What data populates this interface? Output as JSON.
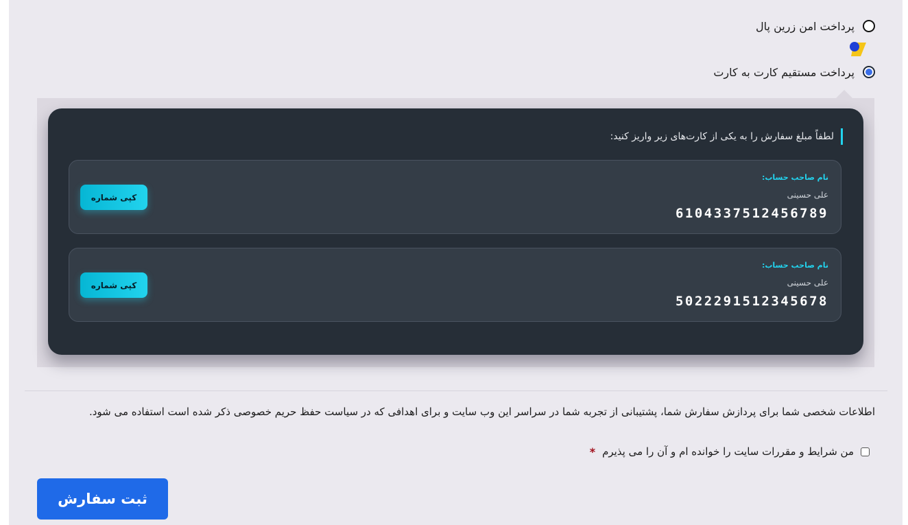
{
  "payment_options": [
    {
      "label": "پرداخت امن زرین پال",
      "checked": false
    },
    {
      "label": "پرداخت مستقیم کارت به کارت",
      "checked": true
    }
  ],
  "card_panel": {
    "instruction": "لطفاً مبلغ سفارش را به یکی از کارت‌های زیر واریز کنید:",
    "accounts": [
      {
        "holder_label": "نام صاحب حساب:",
        "holder_name": "علی حسینی",
        "card_number": "6104337512456789",
        "copy_label": "کپی شماره"
      },
      {
        "holder_label": "نام صاحب حساب:",
        "holder_name": "علی حسینی",
        "card_number": "5022291512345678",
        "copy_label": "کپی شماره"
      }
    ]
  },
  "privacy_text": "اطلاعات شخصی شما برای پردازش سفارش شما، پشتیبانی از تجربه شما در سراسر این وب سایت و برای اهدافی که در سیاست حفظ حریم خصوصی ذکر شده است استفاده می شود.",
  "terms": {
    "label": "من شرایط و مقررات سایت را خوانده ام و آن را می پذیرم",
    "required_mark": "*"
  },
  "submit_label": "ثبت سفارش",
  "colors": {
    "accent_cyan": "#22d3ee",
    "submit_blue": "#1f6ae8",
    "panel_dark": "#262e37"
  }
}
